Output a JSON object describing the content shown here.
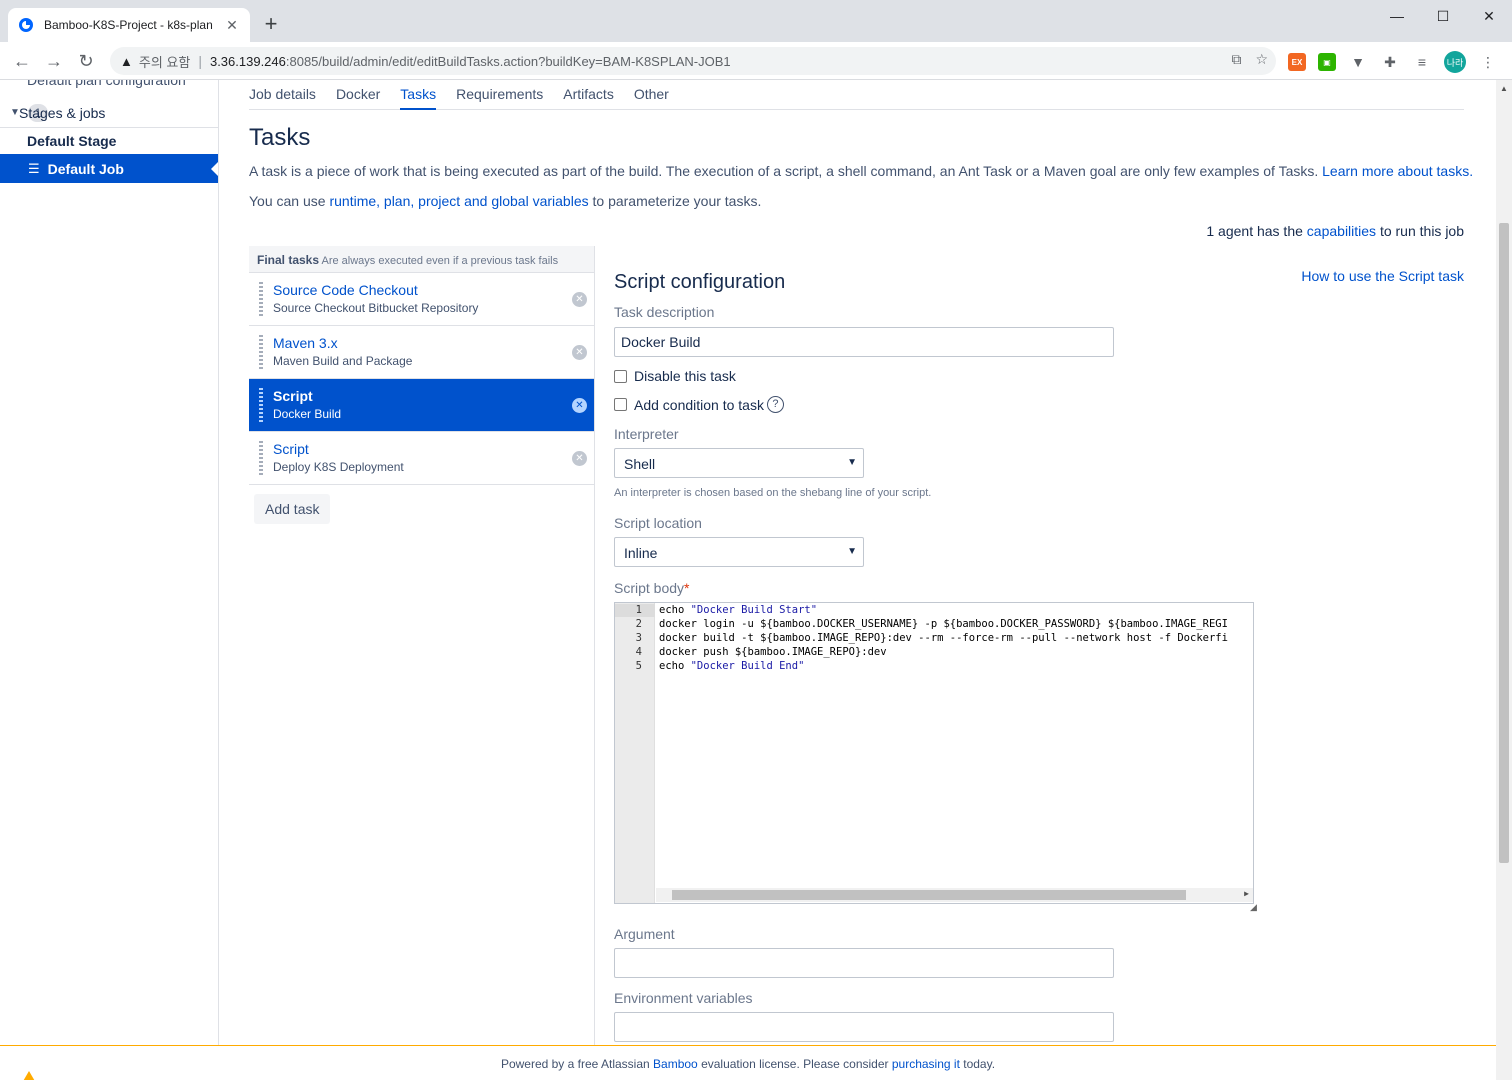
{
  "browser": {
    "tab_title": "Bamboo-K8S-Project - k8s-plan",
    "security_label": "주의 요함",
    "url_host": "3.36.139.246",
    "url_path": ":8085/build/admin/edit/editBuildTasks.action?buildKey=BAM-K8SPLAN-JOB1",
    "profile_label": "나라"
  },
  "sidebar": {
    "cut_item": "Default plan configuration",
    "stages_label": "Stages & jobs",
    "stages_count": "1",
    "stage_name": "Default Stage",
    "job_name": "Default Job"
  },
  "subnav": [
    "Job details",
    "Docker",
    "Tasks",
    "Requirements",
    "Artifacts",
    "Other"
  ],
  "page": {
    "title": "Tasks",
    "desc1": "A task is a piece of work that is being executed as part of the build. The execution of a script, a shell command, an Ant Task or a Maven goal are only few examples of Tasks. ",
    "desc1_link": "Learn more about tasks.",
    "desc2_pre": "You can use ",
    "desc2_link": "runtime, plan, project and global variables",
    "desc2_post": " to parameterize your tasks.",
    "agent_pre": "1 agent has the ",
    "agent_link": "capabilities",
    "agent_post": " to run this job"
  },
  "tasklist": {
    "final_label": "Final tasks",
    "final_note": "Are always executed even if a previous task fails",
    "items": [
      {
        "title": "Source Code Checkout",
        "desc": "Source Checkout Bitbucket Repository"
      },
      {
        "title": "Maven 3.x",
        "desc": "Maven Build and Package"
      },
      {
        "title": "Script",
        "desc": "Docker Build"
      },
      {
        "title": "Script",
        "desc": "Deploy K8S Deployment"
      }
    ],
    "add_label": "Add task"
  },
  "config": {
    "title": "Script configuration",
    "help_link": "How to use the Script task",
    "task_desc_label": "Task description",
    "task_desc_value": "Docker Build",
    "disable_label": "Disable this task",
    "condition_label": "Add condition to task",
    "interpreter_label": "Interpreter",
    "interpreter_value": "Shell",
    "interpreter_hint": "An interpreter is chosen based on the shebang line of your script.",
    "location_label": "Script location",
    "location_value": "Inline",
    "body_label": "Script body",
    "argument_label": "Argument",
    "env_label": "Environment variables",
    "script_lines": [
      {
        "n": "1",
        "kw": "echo ",
        "str": "\"Docker Build Start\""
      },
      {
        "n": "2",
        "kw": "docker login -u ${bamboo.DOCKER_USERNAME} -p ${bamboo.DOCKER_PASSWORD} ${bamboo.IMAGE_REGI",
        "str": ""
      },
      {
        "n": "3",
        "kw": "docker build -t ${bamboo.IMAGE_REPO}:dev --rm --force-rm --pull --network host -f Dockerfi",
        "str": ""
      },
      {
        "n": "4",
        "kw": "docker push ${bamboo.IMAGE_REPO}:dev",
        "str": ""
      },
      {
        "n": "5",
        "kw": "echo ",
        "str": "\"Docker Build End\""
      }
    ]
  },
  "footer": {
    "pre": "Powered by a free Atlassian ",
    "link1": "Bamboo",
    "mid": " evaluation license. Please consider ",
    "link2": "purchasing it",
    "post": " today."
  },
  "colors": {
    "accent": "#0052cc",
    "warning": "#ffab00"
  }
}
